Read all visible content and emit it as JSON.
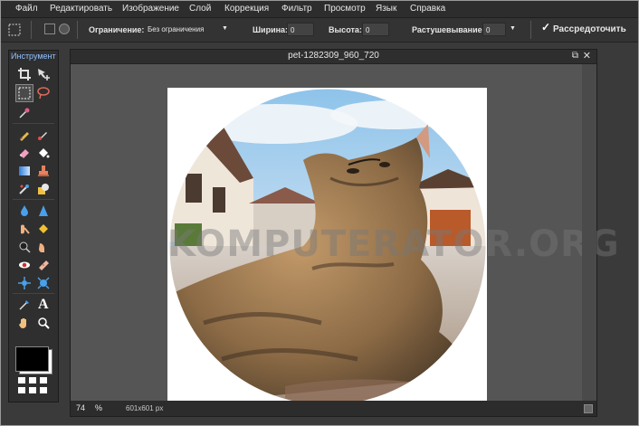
{
  "menu": [
    "Файл",
    "Редактировать",
    "Изображение",
    "Слой",
    "Коррекция",
    "Фильтр",
    "Просмотр",
    "Язык",
    "Справка"
  ],
  "options": {
    "constraint_label": "Ограничение:",
    "constraint_value": "Без ограничения",
    "width_label": "Ширина:",
    "width_value": "0",
    "height_label": "Высота:",
    "height_value": "0",
    "feather_label": "Растушевывание:",
    "feather_value": "0",
    "antialias_label": "Рассредоточить",
    "antialias_checked": true
  },
  "toolbox": {
    "title": "Инструмент",
    "foreground_color": "#000000",
    "background_color": "#ffffff"
  },
  "document": {
    "title": "pet-1282309_960_720",
    "watermark": "KOMPUTERATOR.ORG",
    "zoom_value": "74",
    "zoom_unit": "%",
    "dimensions": "601x601 px"
  },
  "colors": {
    "accent": "#8fc1ff",
    "app_bg": "#3c3c3c",
    "panel_bg": "#2f2f2f",
    "text": "#e6e6e6"
  }
}
